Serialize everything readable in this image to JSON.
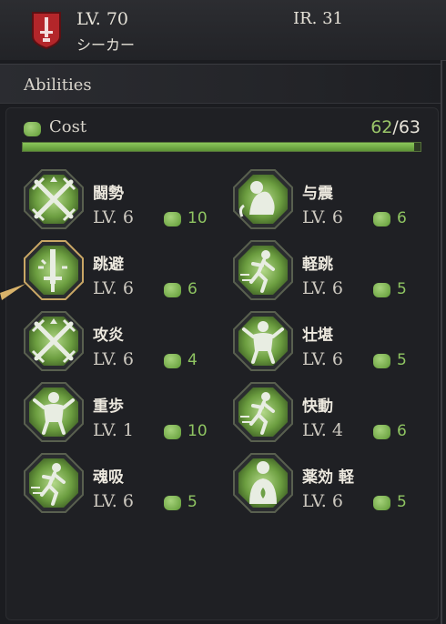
{
  "header": {
    "level": "LV. 70",
    "class_name": "シーカー",
    "ir": "IR. 31"
  },
  "panel": {
    "title": "Abilities",
    "cost_label": "Cost",
    "cost_used": "62",
    "cost_sep": "/",
    "cost_max": "63",
    "cost_fill": 0.984
  },
  "abilities": [
    {
      "name": "闘勢",
      "level": "LV. 6",
      "cost": "10",
      "icon": "crossed-swords-icon"
    },
    {
      "name": "与震",
      "level": "LV. 6",
      "cost": "6",
      "icon": "flexed-arm-icon"
    },
    {
      "name": "跳避",
      "level": "LV. 6",
      "cost": "6",
      "icon": "dodge-sword-icon"
    },
    {
      "name": "軽跳",
      "level": "LV. 6",
      "cost": "5",
      "icon": "running-figure-icon"
    },
    {
      "name": "攻炎",
      "level": "LV. 6",
      "cost": "4",
      "icon": "crossed-swords-icon"
    },
    {
      "name": "壮堪",
      "level": "LV. 6",
      "cost": "5",
      "icon": "strongman-icon"
    },
    {
      "name": "重歩",
      "level": "LV. 1",
      "cost": "10",
      "icon": "strongman-icon"
    },
    {
      "name": "快動",
      "level": "LV. 4",
      "cost": "6",
      "icon": "running-figure-icon"
    },
    {
      "name": "魂吸",
      "level": "LV. 6",
      "cost": "5",
      "icon": "running-figure-icon"
    },
    {
      "name": "薬効 軽",
      "level": "LV. 6",
      "cost": "5",
      "icon": "potion-body-icon"
    }
  ]
}
